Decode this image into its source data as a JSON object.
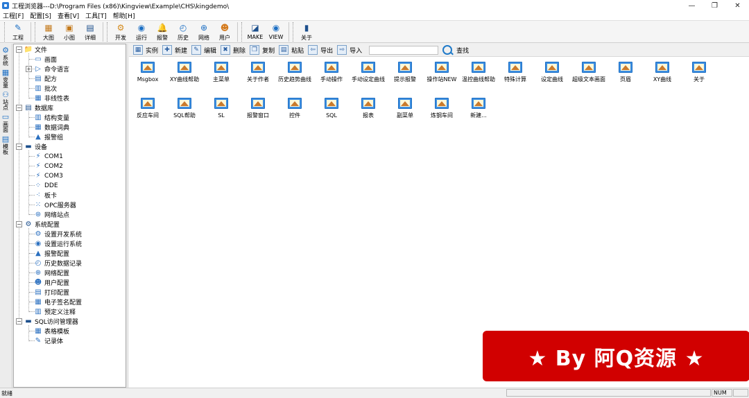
{
  "titlebar": {
    "title": "工程浏览器---D:\\Program Files (x86)\\Kingview\\Example\\CHS\\kingdemo\\",
    "minimize": "—",
    "restore": "❐",
    "close": "✕"
  },
  "menubar": [
    "工程[F]",
    "配置[S]",
    "查看[V]",
    "工具[T]",
    "帮助[H]"
  ],
  "toolbar": {
    "buttons": [
      {
        "label": "工程",
        "icon": "wrench-icon",
        "glyph": "✎",
        "color": "#1c6fc4"
      },
      {
        "label": "大图",
        "icon": "large-icons-icon",
        "glyph": "▦",
        "color": "#c47a1c"
      },
      {
        "label": "小图",
        "icon": "small-icons-icon",
        "glyph": "▣",
        "color": "#c47a1c"
      },
      {
        "label": "详细",
        "icon": "details-icon",
        "glyph": "▤",
        "color": "#1c4f8c"
      },
      {
        "label": "开发",
        "icon": "develop-gear-icon",
        "glyph": "⚙",
        "color": "#d48a1c"
      },
      {
        "label": "运行",
        "icon": "run-icon",
        "glyph": "◉",
        "color": "#1c6fc4"
      },
      {
        "label": "报警",
        "icon": "alarm-bell-icon",
        "glyph": "🔔",
        "color": "#1c6fc4"
      },
      {
        "label": "历史",
        "icon": "history-icon",
        "glyph": "◴",
        "color": "#1c6fc4"
      },
      {
        "label": "网络",
        "icon": "network-globe-icon",
        "glyph": "⊕",
        "color": "#1c6fc4"
      },
      {
        "label": "用户",
        "icon": "user-icon",
        "glyph": "☻",
        "color": "#d47a1c"
      },
      {
        "label": "MAKE",
        "icon": "make-icon",
        "glyph": "◪",
        "color": "#1c4f8c"
      },
      {
        "label": "VIEW",
        "icon": "view-eye-icon",
        "glyph": "◉",
        "color": "#1c6fc4"
      },
      {
        "label": "关于",
        "icon": "about-book-icon",
        "glyph": "▮",
        "color": "#1c4f8c"
      }
    ]
  },
  "vtabs": [
    "系统",
    "变量",
    "站点",
    "画面",
    "模板"
  ],
  "tree": [
    {
      "label": "文件",
      "level": 0,
      "toggle": "−",
      "icon": "folder-icon",
      "glyph": "📁"
    },
    {
      "label": "画面",
      "level": 1,
      "icon": "screen-icon",
      "glyph": "▭"
    },
    {
      "label": "命令语言",
      "level": 1,
      "toggle": "+",
      "icon": "command-icon",
      "glyph": "▷"
    },
    {
      "label": "配方",
      "level": 1,
      "icon": "recipe-icon",
      "glyph": "▤"
    },
    {
      "label": "批次",
      "level": 1,
      "icon": "batch-icon",
      "glyph": "▥"
    },
    {
      "label": "非线性表",
      "level": 1,
      "icon": "table-icon",
      "glyph": "▦"
    },
    {
      "label": "数据库",
      "level": 0,
      "toggle": "−",
      "icon": "database-icon",
      "glyph": "▤"
    },
    {
      "label": "结构变量",
      "level": 1,
      "icon": "struct-icon",
      "glyph": "▥"
    },
    {
      "label": "数据词典",
      "level": 1,
      "icon": "dictionary-icon",
      "glyph": "▦"
    },
    {
      "label": "报警组",
      "level": 1,
      "icon": "alarm-group-icon",
      "glyph": "▲"
    },
    {
      "label": "设备",
      "level": 0,
      "toggle": "−",
      "icon": "device-icon",
      "glyph": "▬"
    },
    {
      "label": "COM1",
      "level": 1,
      "icon": "com-port-icon",
      "glyph": "⚡"
    },
    {
      "label": "COM2",
      "level": 1,
      "icon": "com-port-icon",
      "glyph": "⚡"
    },
    {
      "label": "COM3",
      "level": 1,
      "icon": "com-port-icon",
      "glyph": "⚡"
    },
    {
      "label": "DDE",
      "level": 1,
      "icon": "dde-icon",
      "glyph": "⁘"
    },
    {
      "label": "板卡",
      "level": 1,
      "icon": "card-icon",
      "glyph": "⁖"
    },
    {
      "label": "OPC服务器",
      "level": 1,
      "icon": "opc-icon",
      "glyph": "⁙"
    },
    {
      "label": "网络站点",
      "level": 1,
      "icon": "net-station-icon",
      "glyph": "⊛"
    },
    {
      "label": "系统配置",
      "level": 0,
      "toggle": "−",
      "icon": "system-config-icon",
      "glyph": "⚙"
    },
    {
      "label": "设置开发系统",
      "level": 1,
      "icon": "dev-config-icon",
      "glyph": "⚙"
    },
    {
      "label": "设置运行系统",
      "level": 1,
      "icon": "run-config-icon",
      "glyph": "◉"
    },
    {
      "label": "报警配置",
      "level": 1,
      "icon": "alarm-config-icon",
      "glyph": "▲"
    },
    {
      "label": "历史数据记录",
      "level": 1,
      "icon": "history-record-icon",
      "glyph": "◴"
    },
    {
      "label": "网络配置",
      "level": 1,
      "icon": "network-config-icon",
      "glyph": "⊕"
    },
    {
      "label": "用户配置",
      "level": 1,
      "icon": "user-config-icon",
      "glyph": "☻"
    },
    {
      "label": "打印配置",
      "level": 1,
      "icon": "print-config-icon",
      "glyph": "▤"
    },
    {
      "label": "电子签名配置",
      "level": 1,
      "icon": "signature-icon",
      "glyph": "▦"
    },
    {
      "label": "预定义注释",
      "level": 1,
      "icon": "annotation-icon",
      "glyph": "▥"
    },
    {
      "label": "SQL访问管理器",
      "level": 0,
      "toggle": "−",
      "icon": "sql-manager-icon",
      "glyph": "▬"
    },
    {
      "label": "表格模板",
      "level": 1,
      "icon": "table-template-icon",
      "glyph": "▦"
    },
    {
      "label": "记录体",
      "level": 1,
      "icon": "record-icon",
      "glyph": "✎"
    }
  ],
  "main_toolbar": {
    "buttons": [
      {
        "label": "实例",
        "glyph": "▦"
      },
      {
        "label": "新建",
        "glyph": "✚"
      },
      {
        "label": "编辑",
        "glyph": "✎"
      },
      {
        "label": "删除",
        "glyph": "✖"
      },
      {
        "label": "复制",
        "glyph": "❐"
      },
      {
        "label": "粘贴",
        "glyph": "▤"
      },
      {
        "label": "导出",
        "glyph": "⇦"
      },
      {
        "label": "导入",
        "glyph": "⇨"
      }
    ],
    "search_placeholder": "",
    "search_label": "查找"
  },
  "screens": [
    "Msgbox",
    "XY曲线帮助",
    "主菜单",
    "关于作者",
    "历史趋势曲线",
    "手动操作",
    "手动设定曲线",
    "提示报警",
    "操作站NEW",
    "温控曲线帮助",
    "特殊计算",
    "设定曲线",
    "超级文本画面",
    "页眉",
    "XY曲线",
    "关于",
    "反应车间",
    "SQL帮助",
    "SL",
    "报警窗口",
    "控件",
    "SQL",
    "报表",
    "副菜单",
    "炼钢车间",
    "新建..."
  ],
  "statusbar": {
    "text": "就绪",
    "num": "NUM"
  },
  "watermark": {
    "text": "★ By 阿Q资源 ★"
  }
}
